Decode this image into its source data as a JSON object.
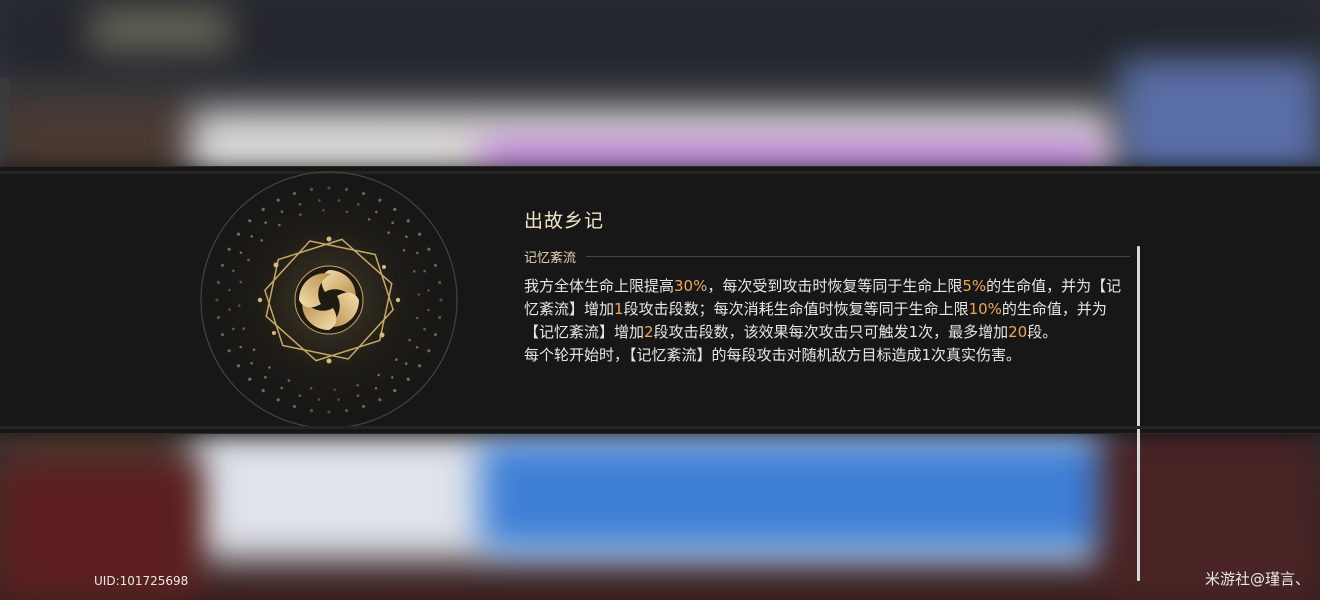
{
  "blessing": {
    "title": "出故乡记",
    "subtitle": "记忆紊流",
    "description": [
      [
        {
          "t": "我方全体生命上限提高"
        },
        {
          "t": "30%",
          "h": true
        },
        {
          "t": "，每次受到攻击时恢复等同于生命上限"
        },
        {
          "t": "5%",
          "h": true
        },
        {
          "t": "的生命值，并为【记忆紊流】增加"
        },
        {
          "t": "1",
          "h": true
        },
        {
          "t": "段攻击段数；每次消耗生命值时恢复等同于生命上限"
        },
        {
          "t": "10%",
          "h": true
        },
        {
          "t": "的生命值，并为【记忆紊流】增加"
        },
        {
          "t": "2",
          "h": true
        },
        {
          "t": "段攻击段数，该效果每次攻击只可触发1次，最多增加"
        },
        {
          "t": "20",
          "h": true
        },
        {
          "t": "段。"
        }
      ],
      [
        {
          "t": "每个轮开始时，【记忆紊流】的每段攻击对随机敌方目标造成1次真实伤害。"
        }
      ]
    ],
    "highlight_color": "#f0a65a",
    "emblem_icon": "swirl-emblem-icon"
  },
  "footer": {
    "uid": "UID:101725698",
    "watermark": "米游社@瑾言、"
  }
}
